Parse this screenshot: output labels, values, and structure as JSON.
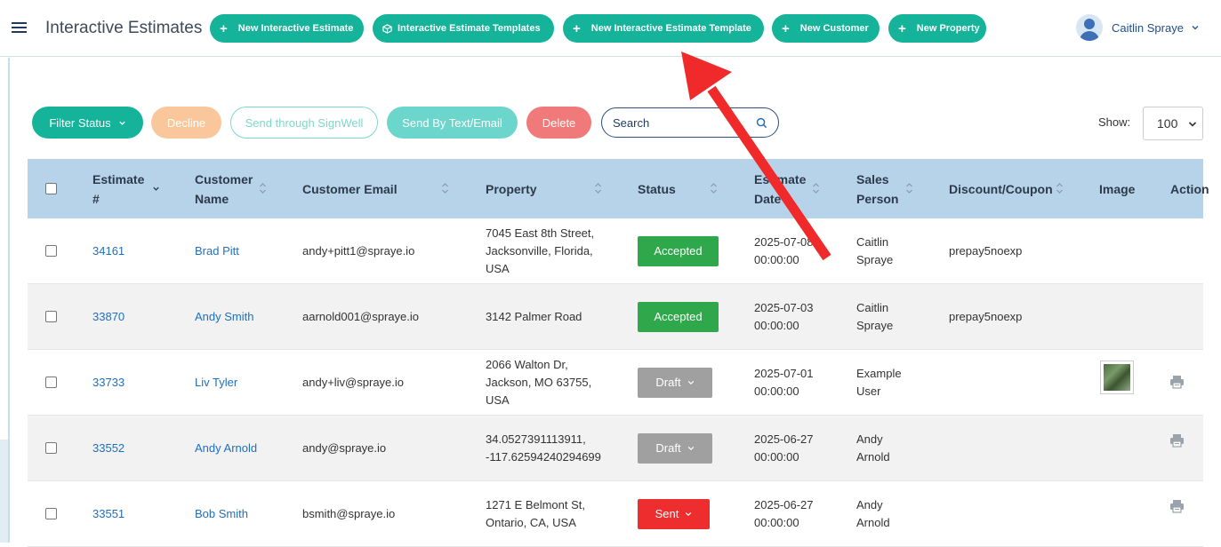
{
  "header": {
    "app_title": "Interactive Estimates",
    "buttons": [
      {
        "label": "New Interactive Estimate",
        "icon": "plus-icon"
      },
      {
        "label": "Interactive Estimate Templates",
        "icon": "cube-icon"
      },
      {
        "label": "New Interactive Estimate Template",
        "icon": "plus-icon"
      },
      {
        "label": "New Customer",
        "icon": "plus-icon"
      },
      {
        "label": "New Property",
        "icon": "plus-icon"
      }
    ],
    "user_name": "Caitlin Spraye"
  },
  "toolbar": {
    "filter_label": "Filter Status",
    "decline_label": "Decline",
    "signwell_label": "Send through SignWell",
    "send_text_label": "Send By Text/Email",
    "delete_label": "Delete",
    "search_placeholder": "Search",
    "show_label": "Show:",
    "show_value": "100"
  },
  "table": {
    "columns": {
      "estimate_line1": "Estimate",
      "estimate_line2": "#",
      "customer_line1": "Customer",
      "customer_line2": "Name",
      "email": "Customer Email",
      "property": "Property",
      "status": "Status",
      "date_line1": "Estimate",
      "date_line2": "Date",
      "sales_line1": "Sales",
      "sales_line2": "Person",
      "discount": "Discount/Coupon",
      "image": "Image",
      "action": "Action"
    },
    "rows": [
      {
        "estimate": "34161",
        "customer": "Brad Pitt",
        "email": "andy+pitt1@spraye.io",
        "property": [
          "7045 East 8th Street,",
          "Jacksonville, Florida,",
          "USA"
        ],
        "status": "Accepted",
        "date": [
          "2025-07-08",
          "00:00:00"
        ],
        "sales": [
          "Caitlin",
          "Spraye"
        ],
        "discount": "prepay5noexp",
        "has_image": false,
        "has_print": false
      },
      {
        "estimate": "33870",
        "customer": "Andy Smith",
        "email": "aarnold001@spraye.io",
        "property": [
          "3142 Palmer Road",
          "",
          ""
        ],
        "status": "Accepted",
        "date": [
          "2025-07-03",
          "00:00:00"
        ],
        "sales": [
          "Caitlin",
          "Spraye"
        ],
        "discount": "prepay5noexp",
        "has_image": false,
        "has_print": false
      },
      {
        "estimate": "33733",
        "customer": "Liv Tyler",
        "email": "andy+liv@spraye.io",
        "property": [
          "2066 Walton Dr,",
          "Jackson, MO 63755,",
          "USA"
        ],
        "status": "Draft",
        "date": [
          "2025-07-01",
          "00:00:00"
        ],
        "sales": [
          "Example",
          "User"
        ],
        "discount": "",
        "has_image": true,
        "has_print": true
      },
      {
        "estimate": "33552",
        "customer": "Andy Arnold",
        "email": "andy@spraye.io",
        "property": [
          "34.0527391113911,",
          "-117.62594240294699",
          ""
        ],
        "status": "Draft",
        "date": [
          "2025-06-27",
          "00:00:00"
        ],
        "sales": [
          "Andy",
          "Arnold"
        ],
        "discount": "",
        "has_image": false,
        "has_print": true
      },
      {
        "estimate": "33551",
        "customer": "Bob Smith",
        "email": "bsmith@spraye.io",
        "property": [
          "1271 E Belmont St,",
          "Ontario, CA, USA",
          ""
        ],
        "status": "Sent",
        "date": [
          "2025-06-27",
          "00:00:00"
        ],
        "sales": [
          "Andy",
          "Arnold"
        ],
        "discount": "",
        "has_image": false,
        "has_print": true
      }
    ]
  },
  "colors": {
    "brand_teal": "#14b39a",
    "accepted": "#2ea84b",
    "draft": "#a0a0a0",
    "sent": "#ee2e2e",
    "table_header": "#b7d3ea",
    "annotation_arrow": "#f02a2a"
  }
}
